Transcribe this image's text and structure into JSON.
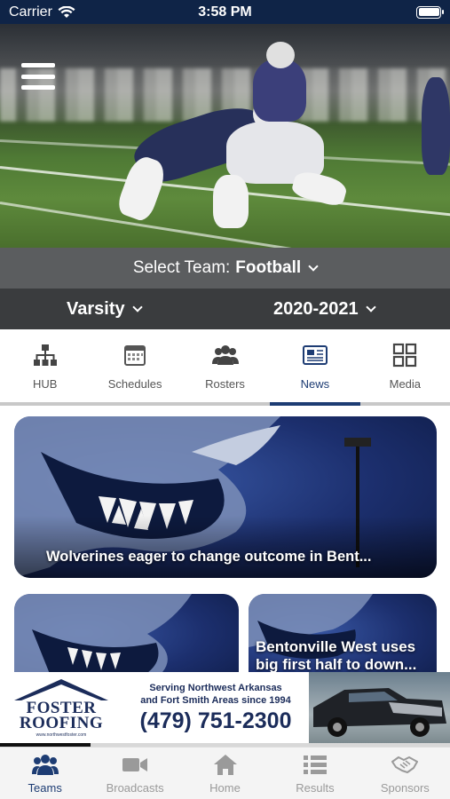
{
  "status_bar": {
    "carrier": "Carrier",
    "time": "3:58 PM"
  },
  "hero": {
    "menu_icon": "hamburger-menu-icon"
  },
  "team_selector": {
    "prefix": "Select Team:",
    "team": "Football"
  },
  "level_selector": {
    "level": "Varsity",
    "season": "2020-2021"
  },
  "sub_tabs": [
    {
      "label": "HUB",
      "icon": "hub-icon"
    },
    {
      "label": "Schedules",
      "icon": "calendar-icon"
    },
    {
      "label": "Rosters",
      "icon": "people-icon"
    },
    {
      "label": "News",
      "icon": "newspaper-icon",
      "active": true
    },
    {
      "label": "Media",
      "icon": "grid-icon"
    }
  ],
  "news": [
    {
      "title": "Wolverines eager to change outcome in Bent..."
    },
    {
      "title": ""
    },
    {
      "title": "Bentonville West uses big first half to down..."
    }
  ],
  "ad": {
    "brand_line1": "FOSTER",
    "brand_line2": "ROOFING",
    "brand_url": "www.northwestfoster.com",
    "tagline1": "Serving Northwest Arkansas",
    "tagline2": "and Fort Smith Areas since 1994",
    "phone": "(479) 751-2300"
  },
  "tab_bar": [
    {
      "label": "Teams",
      "icon": "teams-icon",
      "active": true
    },
    {
      "label": "Broadcasts",
      "icon": "video-camera-icon"
    },
    {
      "label": "Home",
      "icon": "home-icon"
    },
    {
      "label": "Results",
      "icon": "list-icon"
    },
    {
      "label": "Sponsors",
      "icon": "handshake-icon"
    }
  ],
  "colors": {
    "navy": "#1d3c73",
    "status_bar": "#0f2447",
    "select_bar": "#5b5d5f",
    "level_bar": "#3a3c3e"
  }
}
